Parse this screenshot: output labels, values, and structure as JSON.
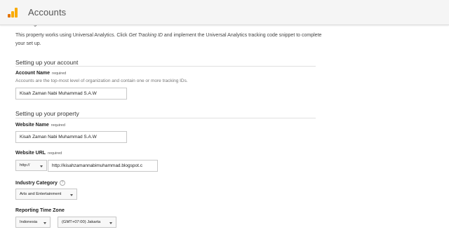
{
  "header": {
    "app_title": "Accounts"
  },
  "tracking": {
    "cut_heading": "Tracking Method",
    "intro_before": "This property works using Universal Analytics. Click ",
    "intro_link": "Get Tracking ID",
    "intro_after": " and implement the Universal Analytics tracking code snippet to complete your set up."
  },
  "account_section": {
    "title": "Setting up your account",
    "account_name_label": "Account Name",
    "required_label": "required",
    "account_name_help": "Accounts are the top-most level of organization and contain one or more tracking IDs.",
    "account_name_value": "Kisah Zaman Nabi Muhammad S.A.W"
  },
  "property_section": {
    "title": "Setting up your property",
    "website_name_label": "Website Name",
    "website_name_required": "required",
    "website_name_value": "Kisah Zaman Nabi Muhammad S.A.W",
    "website_url_label": "Website URL",
    "website_url_required": "required",
    "protocol_value": "http://",
    "website_url_value": "http://kisahzamannabimuhammad.blogspot.c",
    "industry_label": "Industry Category",
    "industry_help_glyph": "?",
    "industry_value": "Arts and Entertainment",
    "timezone_label": "Reporting Time Zone",
    "country_value": "Indonesia",
    "timezone_value": "(GMT+07:00) Jakarta"
  },
  "icons": {
    "logo": "analytics-logo-icon",
    "caret": "chevron-down-icon",
    "help": "help-circle-icon"
  },
  "colors": {
    "logo_dark": "#e37400",
    "logo_light": "#f9ab00",
    "header_bg": "#f5f5f5"
  }
}
